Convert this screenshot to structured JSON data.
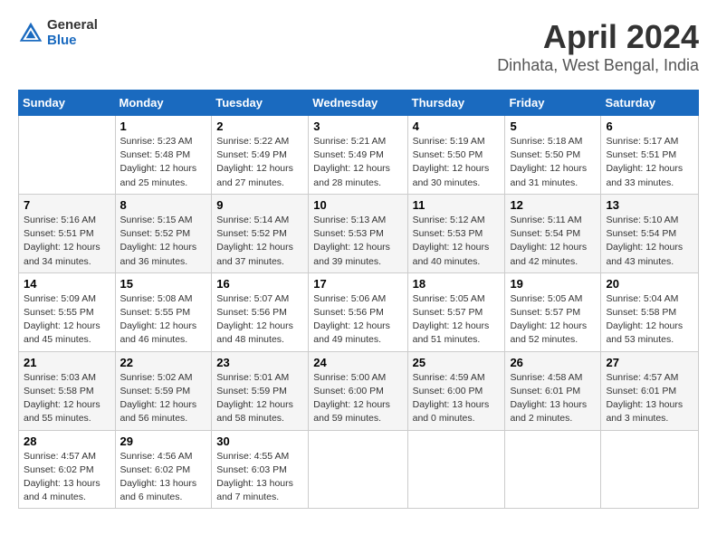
{
  "header": {
    "logo_general": "General",
    "logo_blue": "Blue",
    "title": "April 2024",
    "subtitle": "Dinhata, West Bengal, India"
  },
  "days_of_week": [
    "Sunday",
    "Monday",
    "Tuesday",
    "Wednesday",
    "Thursday",
    "Friday",
    "Saturday"
  ],
  "weeks": [
    [
      {
        "day": "",
        "info": ""
      },
      {
        "day": "1",
        "info": "Sunrise: 5:23 AM\nSunset: 5:48 PM\nDaylight: 12 hours\nand 25 minutes."
      },
      {
        "day": "2",
        "info": "Sunrise: 5:22 AM\nSunset: 5:49 PM\nDaylight: 12 hours\nand 27 minutes."
      },
      {
        "day": "3",
        "info": "Sunrise: 5:21 AM\nSunset: 5:49 PM\nDaylight: 12 hours\nand 28 minutes."
      },
      {
        "day": "4",
        "info": "Sunrise: 5:19 AM\nSunset: 5:50 PM\nDaylight: 12 hours\nand 30 minutes."
      },
      {
        "day": "5",
        "info": "Sunrise: 5:18 AM\nSunset: 5:50 PM\nDaylight: 12 hours\nand 31 minutes."
      },
      {
        "day": "6",
        "info": "Sunrise: 5:17 AM\nSunset: 5:51 PM\nDaylight: 12 hours\nand 33 minutes."
      }
    ],
    [
      {
        "day": "7",
        "info": "Sunrise: 5:16 AM\nSunset: 5:51 PM\nDaylight: 12 hours\nand 34 minutes."
      },
      {
        "day": "8",
        "info": "Sunrise: 5:15 AM\nSunset: 5:52 PM\nDaylight: 12 hours\nand 36 minutes."
      },
      {
        "day": "9",
        "info": "Sunrise: 5:14 AM\nSunset: 5:52 PM\nDaylight: 12 hours\nand 37 minutes."
      },
      {
        "day": "10",
        "info": "Sunrise: 5:13 AM\nSunset: 5:53 PM\nDaylight: 12 hours\nand 39 minutes."
      },
      {
        "day": "11",
        "info": "Sunrise: 5:12 AM\nSunset: 5:53 PM\nDaylight: 12 hours\nand 40 minutes."
      },
      {
        "day": "12",
        "info": "Sunrise: 5:11 AM\nSunset: 5:54 PM\nDaylight: 12 hours\nand 42 minutes."
      },
      {
        "day": "13",
        "info": "Sunrise: 5:10 AM\nSunset: 5:54 PM\nDaylight: 12 hours\nand 43 minutes."
      }
    ],
    [
      {
        "day": "14",
        "info": "Sunrise: 5:09 AM\nSunset: 5:55 PM\nDaylight: 12 hours\nand 45 minutes."
      },
      {
        "day": "15",
        "info": "Sunrise: 5:08 AM\nSunset: 5:55 PM\nDaylight: 12 hours\nand 46 minutes."
      },
      {
        "day": "16",
        "info": "Sunrise: 5:07 AM\nSunset: 5:56 PM\nDaylight: 12 hours\nand 48 minutes."
      },
      {
        "day": "17",
        "info": "Sunrise: 5:06 AM\nSunset: 5:56 PM\nDaylight: 12 hours\nand 49 minutes."
      },
      {
        "day": "18",
        "info": "Sunrise: 5:05 AM\nSunset: 5:57 PM\nDaylight: 12 hours\nand 51 minutes."
      },
      {
        "day": "19",
        "info": "Sunrise: 5:05 AM\nSunset: 5:57 PM\nDaylight: 12 hours\nand 52 minutes."
      },
      {
        "day": "20",
        "info": "Sunrise: 5:04 AM\nSunset: 5:58 PM\nDaylight: 12 hours\nand 53 minutes."
      }
    ],
    [
      {
        "day": "21",
        "info": "Sunrise: 5:03 AM\nSunset: 5:58 PM\nDaylight: 12 hours\nand 55 minutes."
      },
      {
        "day": "22",
        "info": "Sunrise: 5:02 AM\nSunset: 5:59 PM\nDaylight: 12 hours\nand 56 minutes."
      },
      {
        "day": "23",
        "info": "Sunrise: 5:01 AM\nSunset: 5:59 PM\nDaylight: 12 hours\nand 58 minutes."
      },
      {
        "day": "24",
        "info": "Sunrise: 5:00 AM\nSunset: 6:00 PM\nDaylight: 12 hours\nand 59 minutes."
      },
      {
        "day": "25",
        "info": "Sunrise: 4:59 AM\nSunset: 6:00 PM\nDaylight: 13 hours\nand 0 minutes."
      },
      {
        "day": "26",
        "info": "Sunrise: 4:58 AM\nSunset: 6:01 PM\nDaylight: 13 hours\nand 2 minutes."
      },
      {
        "day": "27",
        "info": "Sunrise: 4:57 AM\nSunset: 6:01 PM\nDaylight: 13 hours\nand 3 minutes."
      }
    ],
    [
      {
        "day": "28",
        "info": "Sunrise: 4:57 AM\nSunset: 6:02 PM\nDaylight: 13 hours\nand 4 minutes."
      },
      {
        "day": "29",
        "info": "Sunrise: 4:56 AM\nSunset: 6:02 PM\nDaylight: 13 hours\nand 6 minutes."
      },
      {
        "day": "30",
        "info": "Sunrise: 4:55 AM\nSunset: 6:03 PM\nDaylight: 13 hours\nand 7 minutes."
      },
      {
        "day": "",
        "info": ""
      },
      {
        "day": "",
        "info": ""
      },
      {
        "day": "",
        "info": ""
      },
      {
        "day": "",
        "info": ""
      }
    ]
  ]
}
